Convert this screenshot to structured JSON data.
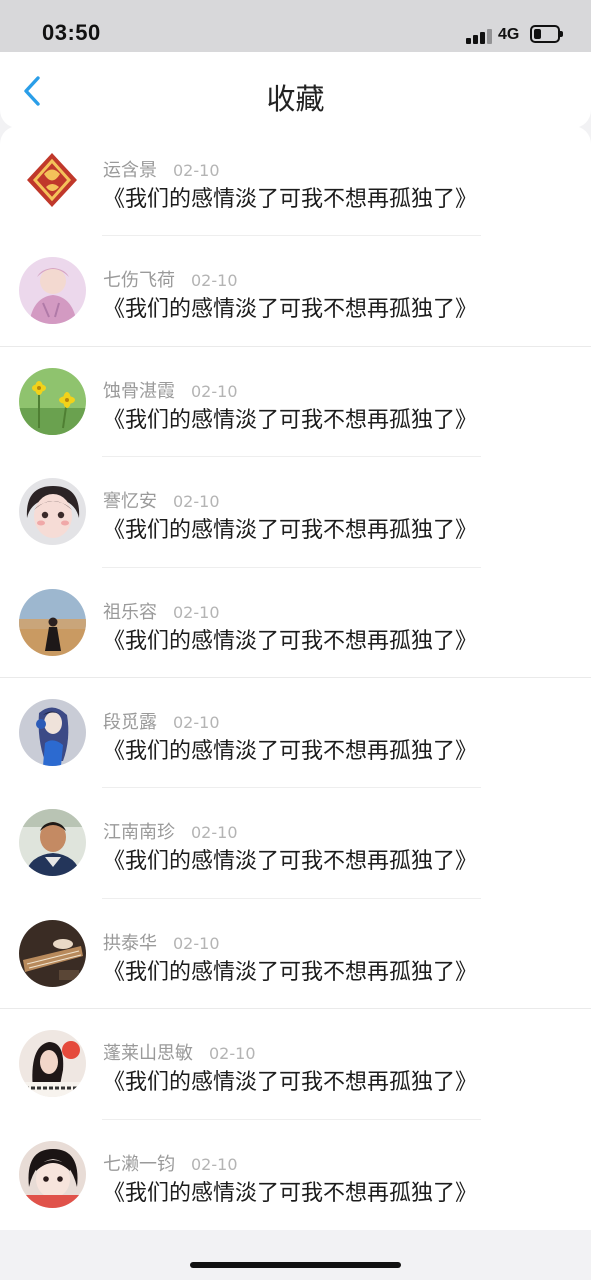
{
  "status_bar": {
    "time": "03:50",
    "network": "4G",
    "battery_level": 0.3,
    "signal_icon": "signal-bars-icon",
    "battery_icon": "battery-icon"
  },
  "header": {
    "back_icon": "chevron-left-icon",
    "title": "收藏"
  },
  "colors": {
    "accent": "#2a9ee8",
    "text_primary": "#1c1c1c",
    "text_secondary": "#9a9a9a",
    "background": "#f2f2f4"
  },
  "favorites": [
    {
      "name": "运含景",
      "date": "02-10",
      "title": "《我们的感情淡了可我不想再孤独了》"
    },
    {
      "name": "七伤飞荷",
      "date": "02-10",
      "title": "《我们的感情淡了可我不想再孤独了》"
    },
    {
      "name": "蚀骨湛霞",
      "date": "02-10",
      "title": "《我们的感情淡了可我不想再孤独了》"
    },
    {
      "name": "謇忆安",
      "date": "02-10",
      "title": "《我们的感情淡了可我不想再孤独了》"
    },
    {
      "name": "祖乐容",
      "date": "02-10",
      "title": "《我们的感情淡了可我不想再孤独了》"
    },
    {
      "name": "段觅露",
      "date": "02-10",
      "title": "《我们的感情淡了可我不想再孤独了》"
    },
    {
      "name": "江南南珍",
      "date": "02-10",
      "title": "《我们的感情淡了可我不想再孤独了》"
    },
    {
      "name": "拱泰华",
      "date": "02-10",
      "title": "《我们的感情淡了可我不想再孤独了》"
    },
    {
      "name": "蓬莱山思敏",
      "date": "02-10",
      "title": "《我们的感情淡了可我不想再孤独了》"
    },
    {
      "name": "七濑一钧",
      "date": "02-10",
      "title": "《我们的感情淡了可我不想再孤独了》"
    }
  ]
}
